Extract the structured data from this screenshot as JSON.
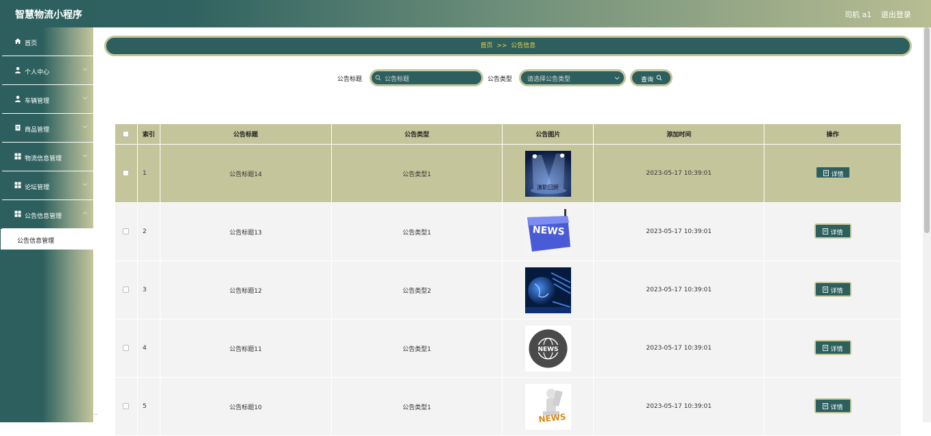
{
  "header": {
    "title": "智慧物流小程序",
    "user": "司机 a1",
    "logout_label": "退出登录"
  },
  "sidebar": {
    "items": [
      {
        "label": "首页",
        "icon": "home-icon",
        "expandable": false
      },
      {
        "label": "个人中心",
        "icon": "user-icon",
        "expandable": true
      },
      {
        "label": "车辆管理",
        "icon": "user-icon",
        "expandable": true
      },
      {
        "label": "商品管理",
        "icon": "clipboard-icon",
        "expandable": true
      },
      {
        "label": "物流信息管理",
        "icon": "grid-icon",
        "expandable": true
      },
      {
        "label": "论坛管理",
        "icon": "grid-icon",
        "expandable": true
      },
      {
        "label": "公告信息管理",
        "icon": "grid-icon",
        "expandable": true
      }
    ],
    "sub_item": "公告信息管理",
    "dots": ".."
  },
  "breadcrumb": {
    "home": "首页",
    "sep": ">>",
    "current": "公告信息"
  },
  "search": {
    "title_label": "公告标题",
    "title_placeholder": "公告标题",
    "type_label": "公告类型",
    "type_placeholder": "请选择公告类型",
    "button_label": "查询"
  },
  "table": {
    "headers": {
      "index": "索引",
      "title": "公告标题",
      "type": "公告类型",
      "image": "公告图片",
      "time": "添加时间",
      "action": "操作"
    },
    "detail_label": "详情",
    "rows": [
      {
        "index": "1",
        "title": "公告标题14",
        "type": "公告类型1",
        "image": "stage-spotlight-image",
        "time": "2023-05-17 10:39:01",
        "image_text": "演职回顾"
      },
      {
        "index": "2",
        "title": "公告标题13",
        "type": "公告类型1",
        "image": "news-key-image",
        "time": "2023-05-17 10:39:01",
        "image_text": "NEWS"
      },
      {
        "index": "3",
        "title": "公告标题12",
        "type": "公告类型2",
        "image": "globe-image",
        "time": "2023-05-17 10:39:01",
        "image_text": ""
      },
      {
        "index": "4",
        "title": "公告标题11",
        "type": "公告类型1",
        "image": "news-globe-circle-image",
        "time": "2023-05-17 10:39:01",
        "image_text": "NEWS"
      },
      {
        "index": "5",
        "title": "公告标题10",
        "type": "公告类型1",
        "image": "news-figure-image",
        "time": "2023-05-17 10:39:01",
        "image_text": "NEWS"
      }
    ]
  },
  "colors": {
    "primary": "#2c5f5d",
    "accent": "#c4c59a",
    "breadcrumb_text": "#f0d44a"
  }
}
